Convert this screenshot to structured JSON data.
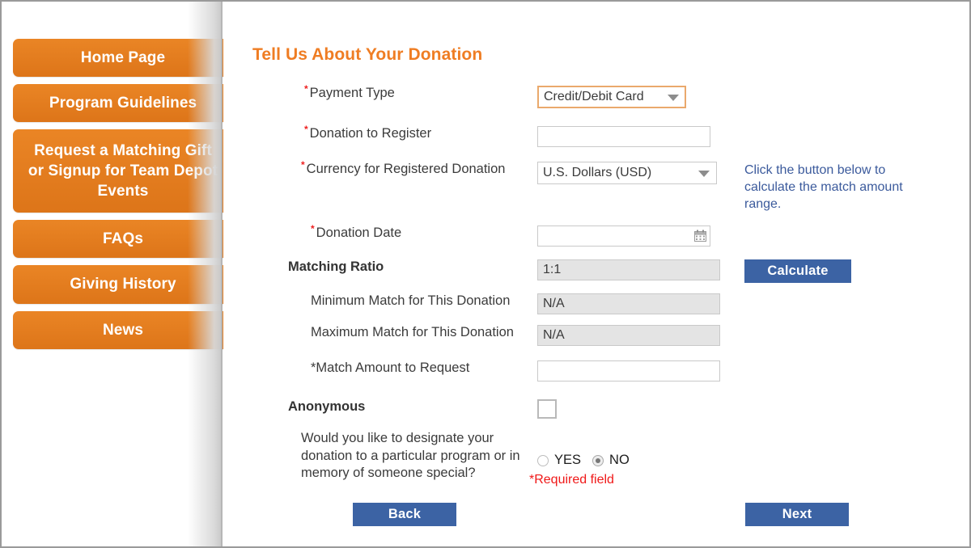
{
  "sidebar": {
    "items": [
      {
        "label": "Home Page",
        "tall": false
      },
      {
        "label": "Program Guidelines",
        "tall": false
      },
      {
        "label": "Request a Matching Gift or Signup for Team Depot Events",
        "tall": true
      },
      {
        "label": "FAQs",
        "tall": false
      },
      {
        "label": "Giving History",
        "tall": false
      },
      {
        "label": "News",
        "tall": false
      }
    ]
  },
  "form": {
    "title": "Tell Us About Your Donation",
    "payment_type": {
      "label": "Payment Type",
      "value": "Credit/Debit Card",
      "required": true
    },
    "donation_to_register": {
      "label": "Donation to Register",
      "value": "",
      "required": true
    },
    "currency": {
      "label": "Currency for Registered Donation",
      "value": "U.S. Dollars (USD)",
      "required": true
    },
    "donation_date": {
      "label": "Donation Date",
      "value": "",
      "required": true,
      "icon": "calendar-icon"
    },
    "matching_ratio": {
      "label": "Matching Ratio",
      "value": "1:1"
    },
    "minimum_match": {
      "label": "Minimum Match for This Donation",
      "value": "N/A"
    },
    "maximum_match": {
      "label": "Maximum Match for This Donation",
      "value": "N/A"
    },
    "match_amount": {
      "label": "*Match Amount to Request",
      "value": ""
    },
    "anonymous": {
      "label": "Anonymous",
      "checked": false
    },
    "designate": {
      "question": "Would you like to designate your donation to a particular program or in memory of someone special?",
      "options": [
        "YES",
        "NO"
      ],
      "selected": "NO"
    },
    "help_text": "Click the button below to calculate the match amount range.",
    "calculate_label": "Calculate",
    "required_note": "*Required field",
    "back_label": "Back",
    "next_label": "Next"
  },
  "colors": {
    "brand_orange": "#ef7d23",
    "nav_orange": "#e8801e",
    "button_blue": "#3c63a4",
    "help_blue": "#3b5a9c",
    "required_red": "#ee2020"
  }
}
